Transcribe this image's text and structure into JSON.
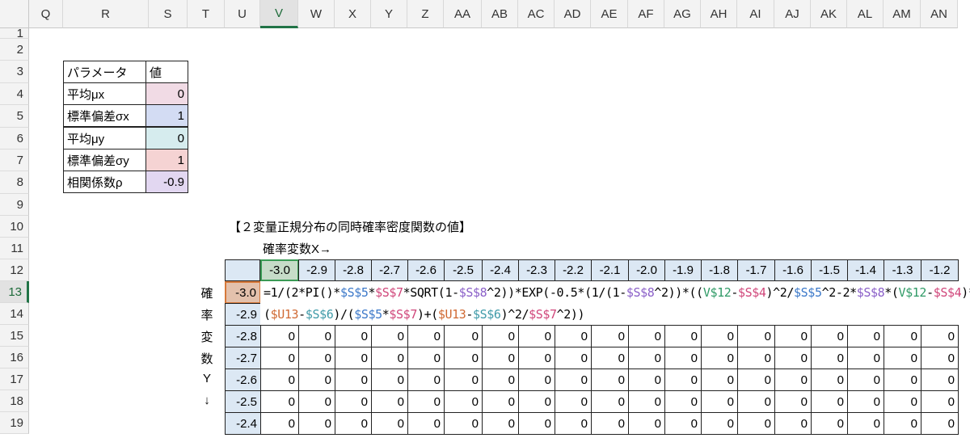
{
  "columns": [
    "Q",
    "R",
    "S",
    "T",
    "U",
    "V",
    "W",
    "X",
    "Y",
    "Z",
    "AA",
    "AB",
    "AC",
    "AD",
    "AE",
    "AF",
    "AG",
    "AH",
    "AI",
    "AJ",
    "AK",
    "AL",
    "AM",
    "AN"
  ],
  "selected_column": "V",
  "rows": [
    "1",
    "2",
    "3",
    "4",
    "5",
    "6",
    "7",
    "8",
    "9",
    "10",
    "11",
    "12",
    "13",
    "14",
    "15",
    "16",
    "17",
    "18",
    "19"
  ],
  "selected_row": "13",
  "params": {
    "header_label": "パラメータ",
    "header_value": "値",
    "items": [
      {
        "label": "平均μx",
        "value": "0",
        "color": "#f1dbe5"
      },
      {
        "label": "標準偏差σx",
        "value": "1",
        "color": "#d3dcf3"
      },
      {
        "label": "平均μy",
        "value": "0",
        "color": "#d6ecee"
      },
      {
        "label": "標準偏差σy",
        "value": "1",
        "color": "#f5d3d3"
      },
      {
        "label": "相関係数ρ",
        "value": "-0.9",
        "color": "#e2d7f1"
      }
    ]
  },
  "table_title": "【２変量正規分布の同時確率密度関数の値】",
  "x_caption": "確率変数X→",
  "y_caption": [
    "確",
    "率",
    "変",
    "数",
    "Y",
    "↓"
  ],
  "x_values": [
    "-3.0",
    "-2.9",
    "-2.8",
    "-2.7",
    "-2.6",
    "-2.5",
    "-2.4",
    "-2.3",
    "-2.2",
    "-2.1",
    "-2.0",
    "-1.9",
    "-1.8",
    "-1.7",
    "-1.6",
    "-1.5",
    "-1.4",
    "-1.3",
    "-1.2"
  ],
  "y_values": [
    "-3.0",
    "-2.9",
    "-2.8",
    "-2.7",
    "-2.6",
    "-2.5",
    "-2.4"
  ],
  "zero": "0",
  "formula_line1": [
    {
      "t": "=1/(2*PI()*",
      "c": ""
    },
    {
      "t": "$S$5",
      "c": "ref1"
    },
    {
      "t": "*",
      "c": ""
    },
    {
      "t": "$S$7",
      "c": "ref2"
    },
    {
      "t": "*SQRT(1-",
      "c": ""
    },
    {
      "t": "$S$8",
      "c": "ref3"
    },
    {
      "t": "^2))*EXP(-0.5*(1/(1-",
      "c": ""
    },
    {
      "t": "$S$8",
      "c": "ref3"
    },
    {
      "t": "^2))*((",
      "c": ""
    },
    {
      "t": "V$12",
      "c": "ref4"
    },
    {
      "t": "-",
      "c": ""
    },
    {
      "t": "$S$4",
      "c": "ref2"
    },
    {
      "t": ")^2/",
      "c": ""
    },
    {
      "t": "$S$5",
      "c": "ref1"
    },
    {
      "t": "^2-2*",
      "c": ""
    },
    {
      "t": "$S$8",
      "c": "ref3"
    },
    {
      "t": "*(",
      "c": ""
    },
    {
      "t": "V$12",
      "c": "ref4"
    },
    {
      "t": "-",
      "c": ""
    },
    {
      "t": "$S$4",
      "c": "ref2"
    },
    {
      "t": ")*",
      "c": ""
    }
  ],
  "formula_line2": [
    {
      "t": "(",
      "c": ""
    },
    {
      "t": "$U13",
      "c": "ref5"
    },
    {
      "t": "-",
      "c": ""
    },
    {
      "t": "$S$6",
      "c": "ref6"
    },
    {
      "t": ")/(",
      "c": ""
    },
    {
      "t": "$S$5",
      "c": "ref1"
    },
    {
      "t": "*",
      "c": ""
    },
    {
      "t": "$S$7",
      "c": "ref2"
    },
    {
      "t": ")+(",
      "c": ""
    },
    {
      "t": "$U13",
      "c": "ref5"
    },
    {
      "t": "-",
      "c": ""
    },
    {
      "t": "$S$6",
      "c": "ref6"
    },
    {
      "t": ")^2/",
      "c": ""
    },
    {
      "t": "$S$7",
      "c": "ref2"
    },
    {
      "t": "^2))",
      "c": ""
    }
  ]
}
